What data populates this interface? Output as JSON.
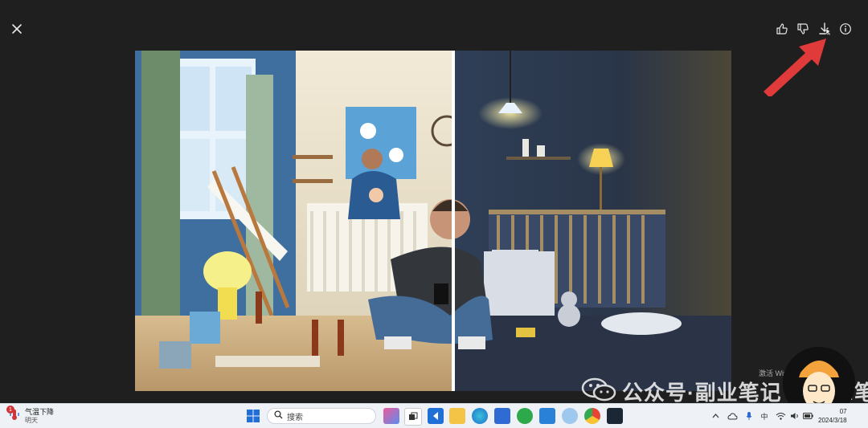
{
  "viewer": {
    "close_icon": "close-icon",
    "toolbar": {
      "like_icon": "thumbs-up-icon",
      "dislike_icon": "thumbs-down-icon",
      "download_icon": "download-icon",
      "info_icon": "info-icon"
    }
  },
  "overlay": {
    "activate_text": "激活 Windows",
    "watermark": "公众号·副业笔记 林杰AI笔记"
  },
  "taskbar": {
    "weather": {
      "title": "气温下降",
      "subtitle": "明天",
      "badge": "1"
    },
    "search_placeholder": "搜索",
    "tray": {
      "ime": "中"
    },
    "clock": {
      "time": "07",
      "date": "2024/3/18"
    }
  },
  "colors": {
    "viewer_bg": "#1f1f1f",
    "arrow": "#e03a3a",
    "taskbar_bg": "#eef1f6"
  }
}
